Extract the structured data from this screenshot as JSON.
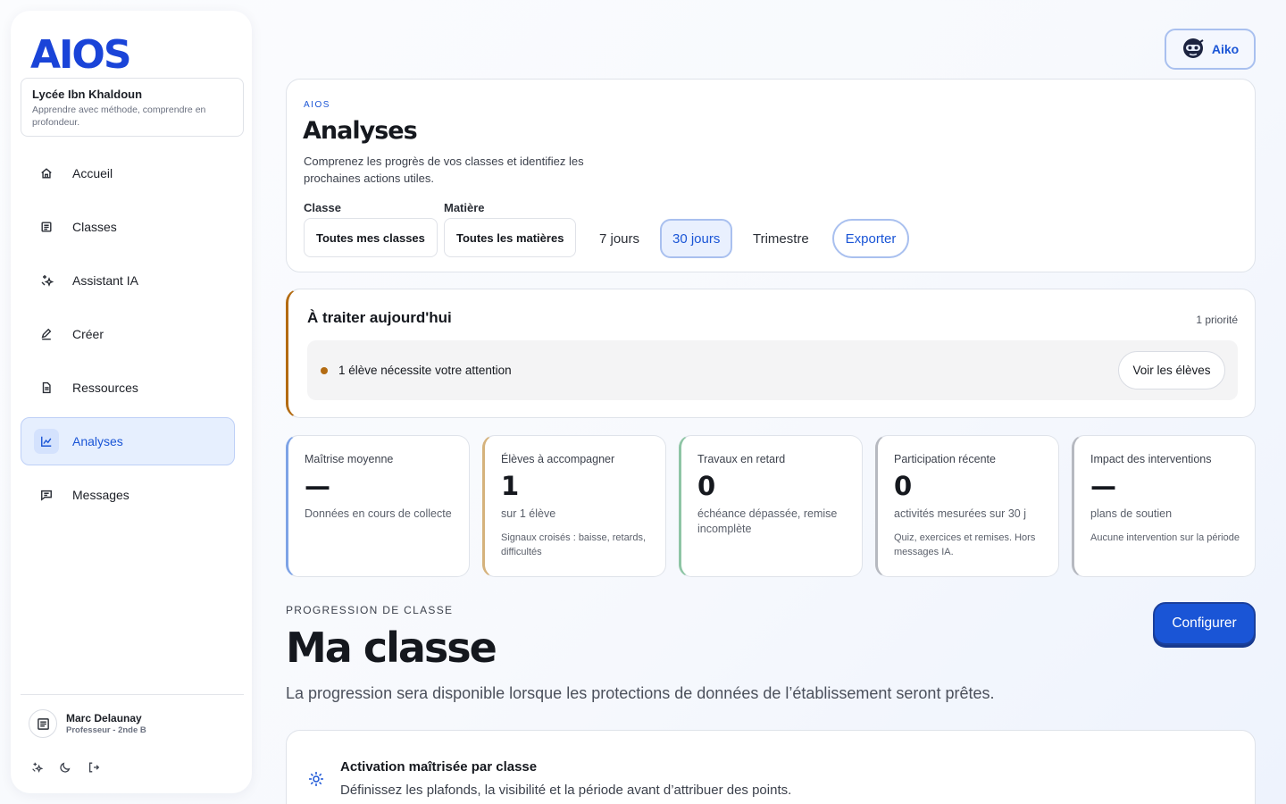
{
  "app": {
    "logo": "AIOS"
  },
  "school": {
    "name": "Lycée Ibn Khaldoun",
    "motto": "Apprendre avec méthode, comprendre en profondeur."
  },
  "nav": [
    {
      "label": "Accueil",
      "icon": "home-icon"
    },
    {
      "label": "Classes",
      "icon": "list-icon"
    },
    {
      "label": "Assistant IA",
      "icon": "sparkles-icon"
    },
    {
      "label": "Créer",
      "icon": "pencil-icon"
    },
    {
      "label": "Ressources",
      "icon": "document-icon"
    },
    {
      "label": "Analyses",
      "icon": "chart-icon",
      "active": true
    },
    {
      "label": "Messages",
      "icon": "message-icon"
    }
  ],
  "user": {
    "name": "Marc Delaunay",
    "role": "Professeur - 2nde B"
  },
  "assistant": {
    "name": "Aiko"
  },
  "header": {
    "eyebrow": "AIOS",
    "title": "Analyses",
    "subtitle": "Comprenez les progrès de vos classes et identifiez les prochaines actions utiles.",
    "class_label": "Classe",
    "class_value": "Toutes mes classes",
    "subject_label": "Matière",
    "subject_value": "Toutes les matières",
    "periods": [
      "7 jours",
      "30 jours",
      "Trimestre"
    ],
    "selected_period": "30 jours",
    "export_label": "Exporter"
  },
  "today": {
    "title": "À traiter aujourd'hui",
    "count": "1 priorité",
    "alert": "1 élève nécessite votre attention",
    "action": "Voir les élèves"
  },
  "kpis": [
    {
      "label": "Maîtrise moyenne",
      "value": "—",
      "desc": "Données en cours de collecte",
      "note": "",
      "accent": "#7ea3e6"
    },
    {
      "label": "Élèves à accompagner",
      "value": "1",
      "desc": "sur 1 élève",
      "note": "Signaux croisés : baisse, retards, difficultés",
      "accent": "#d5b27c"
    },
    {
      "label": "Travaux en retard",
      "value": "0",
      "desc": "échéance dépassée, remise incomplète",
      "note": "",
      "accent": "#8ec5a5"
    },
    {
      "label": "Participation récente",
      "value": "0",
      "desc": "activités mesurées sur 30 j",
      "note": "Quiz, exercices et remises. Hors messages IA.",
      "accent": "#b6b9c0"
    },
    {
      "label": "Impact des interventions",
      "value": "—",
      "desc": "plans de soutien",
      "note": "Aucune intervention sur la période",
      "accent": "#b6b9c0"
    }
  ],
  "progression": {
    "eyebrow": "PROGRESSION DE CLASSE",
    "title": "Ma classe",
    "description": "La progression sera disponible lorsque les protections de données de l’établissement seront prêtes.",
    "configure_label": "Configurer"
  },
  "activation": {
    "title": "Activation maîtrisée par classe",
    "description": "Définissez les plafonds, la visibilité et la période avant d’attribuer des points."
  },
  "colors": {
    "brand": "#1a55d6",
    "warning": "#b36b12"
  }
}
